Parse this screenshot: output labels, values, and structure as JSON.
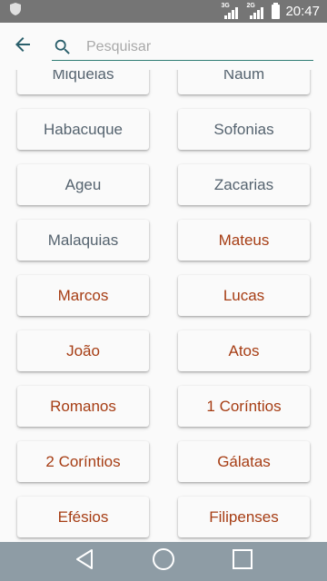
{
  "status_bar": {
    "time": "20:47",
    "signals": [
      {
        "net": "3G"
      },
      {
        "net": "2G"
      }
    ]
  },
  "search": {
    "placeholder": "Pesquisar",
    "value": ""
  },
  "colors": {
    "old_testament_text": "#55636f",
    "new_testament_text": "#a63d14",
    "search_underline": "#2e7d74",
    "nav_bar": "#8e9ca5",
    "status_bar": "#757575"
  },
  "books": [
    {
      "label": "Miquéias",
      "testament": "ot"
    },
    {
      "label": "Naum",
      "testament": "ot"
    },
    {
      "label": "Habacuque",
      "testament": "ot"
    },
    {
      "label": "Sofonias",
      "testament": "ot"
    },
    {
      "label": "Ageu",
      "testament": "ot"
    },
    {
      "label": "Zacarias",
      "testament": "ot"
    },
    {
      "label": "Malaquias",
      "testament": "ot"
    },
    {
      "label": "Mateus",
      "testament": "nt"
    },
    {
      "label": "Marcos",
      "testament": "nt"
    },
    {
      "label": "Lucas",
      "testament": "nt"
    },
    {
      "label": "João",
      "testament": "nt"
    },
    {
      "label": "Atos",
      "testament": "nt"
    },
    {
      "label": "Romanos",
      "testament": "nt"
    },
    {
      "label": "1 Coríntios",
      "testament": "nt"
    },
    {
      "label": "2 Coríntios",
      "testament": "nt"
    },
    {
      "label": "Gálatas",
      "testament": "nt"
    },
    {
      "label": "Efésios",
      "testament": "nt"
    },
    {
      "label": "Filipenses",
      "testament": "nt"
    }
  ],
  "icons": {
    "status_left": "shield-icon",
    "back": "arrow-back-icon",
    "search": "search-icon",
    "nav_back": "triangle-back-icon",
    "nav_home": "circle-home-icon",
    "nav_recents": "square-recents-icon"
  }
}
